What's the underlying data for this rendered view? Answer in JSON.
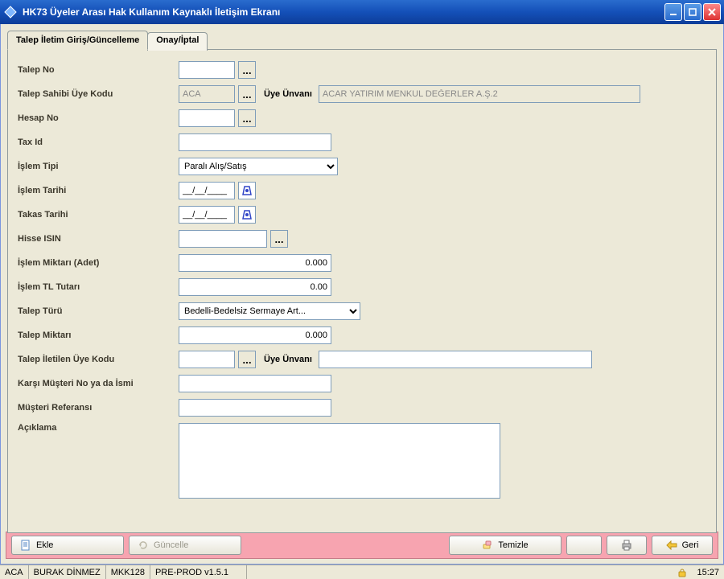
{
  "window": {
    "title": "HK73 Üyeler Arası Hak Kullanım Kaynaklı İletişim Ekranı"
  },
  "tabs": {
    "t1": "Talep İletim Giriş/Güncelleme",
    "t2": "Onay/İptal"
  },
  "labels": {
    "talepNo": "Talep No",
    "talepSahibi": "Talep Sahibi Üye Kodu",
    "uyeUnvani": "Üye Ünvanı",
    "hesapNo": "Hesap No",
    "taxId": "Tax Id",
    "islemTipi": "İşlem Tipi",
    "islemTarihi": "İşlem Tarihi",
    "takasTarihi": "Takas Tarihi",
    "hisseIsin": "Hisse ISIN",
    "islemMiktari": "İşlem Miktarı (Adet)",
    "islemTL": "İşlem TL Tutarı",
    "talepTuru": "Talep Türü",
    "talepMiktari": "Talep Miktarı",
    "talepIletilen": "Talep İletilen Üye Kodu",
    "karsiMusteri": "Karşı Müşteri No ya da İsmi",
    "musteriRef": "Müşteri Referansı",
    "aciklama": "Açıklama"
  },
  "values": {
    "talepNo": "",
    "talepSahibi": "ACA",
    "uyeUnvani1": "ACAR YATIRIM MENKUL DEĞERLER A.Ş.2",
    "hesapNo": "",
    "taxId": "",
    "islemTarihi": "__/__/____",
    "takasTarihi": "__/__/____",
    "hisseIsin": "",
    "islemMiktari": "0.000",
    "islemTL": "0.00",
    "talepMiktari": "0.000",
    "talepIletilen": "",
    "uyeUnvani2": "",
    "karsiMusteri": "",
    "musteriRef": "",
    "aciklama": ""
  },
  "selects": {
    "islemTipi": "Paralı Alış/Satış",
    "talepTuru": "Bedelli-Bedelsiz Sermaye Art..."
  },
  "buttons": {
    "ekle": "Ekle",
    "guncelle": "Güncelle",
    "temizle": "Temizle",
    "geri": "Geri",
    "lookup": "..."
  },
  "status": {
    "c1": "ACA",
    "c2": "BURAK DİNMEZ",
    "c3": "MKK128",
    "c4": "PRE-PROD v1.5.1",
    "time": "15:27"
  }
}
